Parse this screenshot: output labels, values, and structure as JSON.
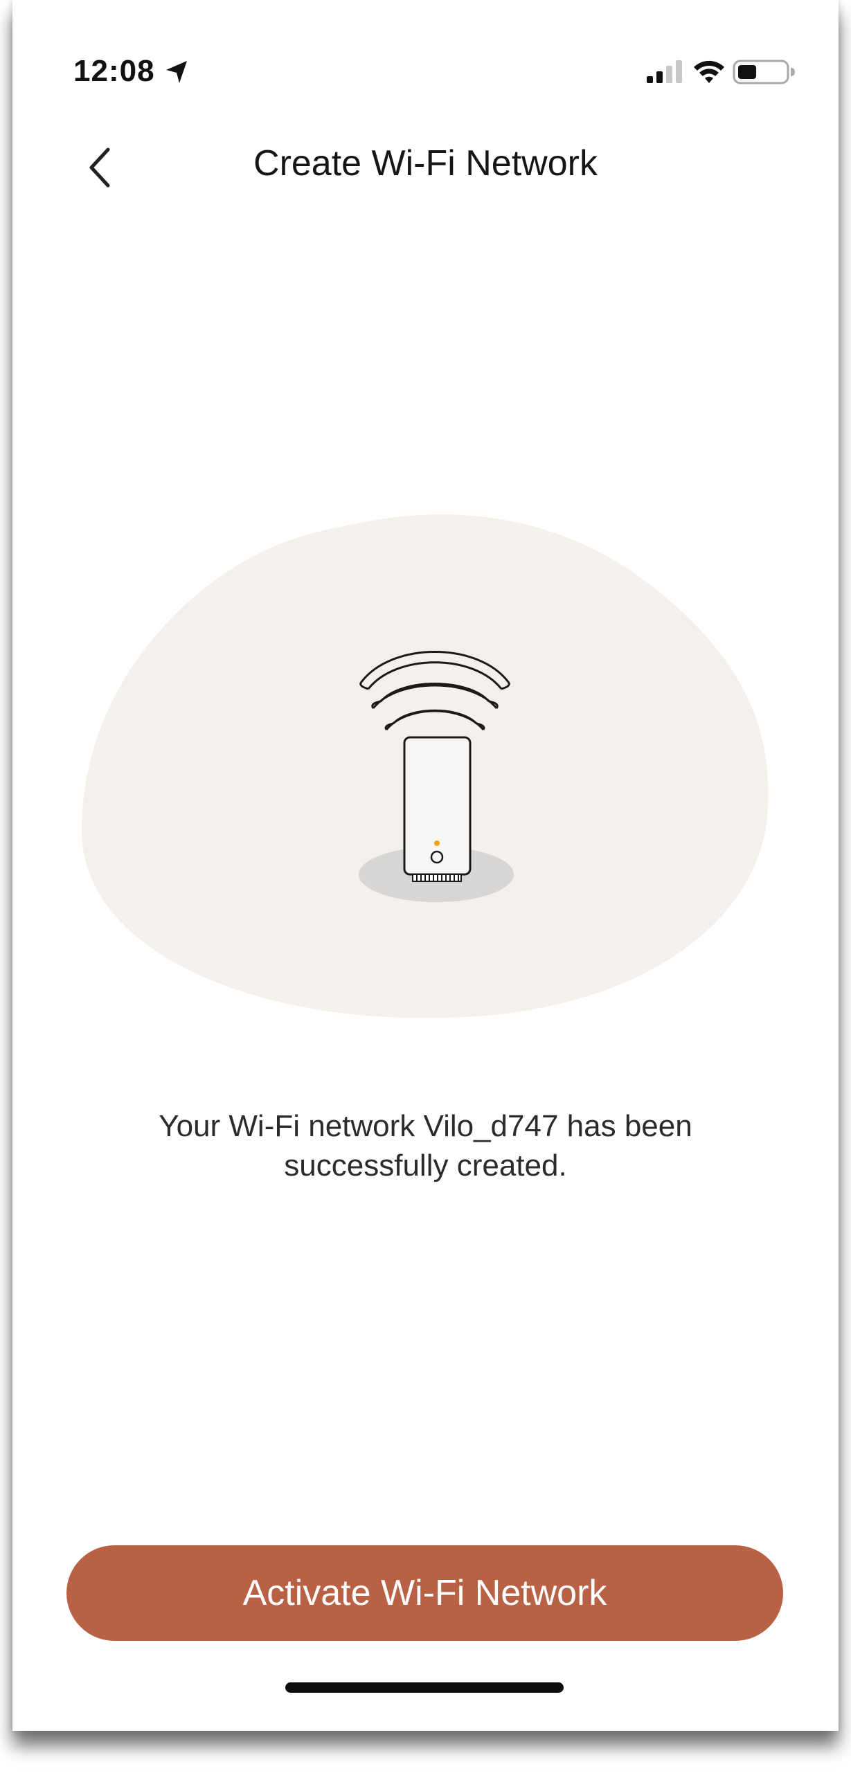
{
  "status_bar": {
    "time": "12:08",
    "icons": [
      "location-arrow-icon",
      "cellular-signal-icon",
      "wifi-icon",
      "battery-icon"
    ]
  },
  "header": {
    "title": "Create Wi-Fi Network",
    "back_icon": "chevron-left-icon"
  },
  "illustration": {
    "subject": "wifi-router-icon",
    "blob_color": "#f4f1ec",
    "indicator_color": "#f2a20d"
  },
  "main": {
    "message_line1": "Your Wi-Fi network Vilo_d747 has been",
    "message_line2": "successfully created."
  },
  "footer": {
    "activate_label": "Activate Wi-Fi Network",
    "accent_color": "#b86144"
  }
}
